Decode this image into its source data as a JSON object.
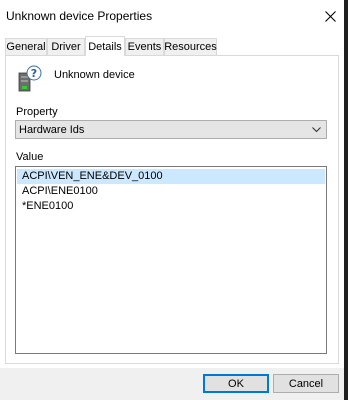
{
  "window": {
    "title": "Unknown device Properties",
    "close_icon": "close-icon"
  },
  "tabs": [
    {
      "label": "General"
    },
    {
      "label": "Driver"
    },
    {
      "label": "Details",
      "active": true
    },
    {
      "label": "Events"
    },
    {
      "label": "Resources"
    }
  ],
  "device": {
    "icon": "unknown-device-icon",
    "name": "Unknown device"
  },
  "property": {
    "label": "Property",
    "selected": "Hardware Ids"
  },
  "value": {
    "label": "Value",
    "items": [
      "ACPI\\VEN_ENE&DEV_0100",
      "ACPI\\ENE0100",
      "*ENE0100"
    ],
    "selected_index": 0
  },
  "buttons": {
    "ok": "OK",
    "cancel": "Cancel"
  },
  "colors": {
    "selection": "#cce8ff",
    "default_button_border": "#0078d7",
    "footer_bg": "#f0f0f0"
  }
}
